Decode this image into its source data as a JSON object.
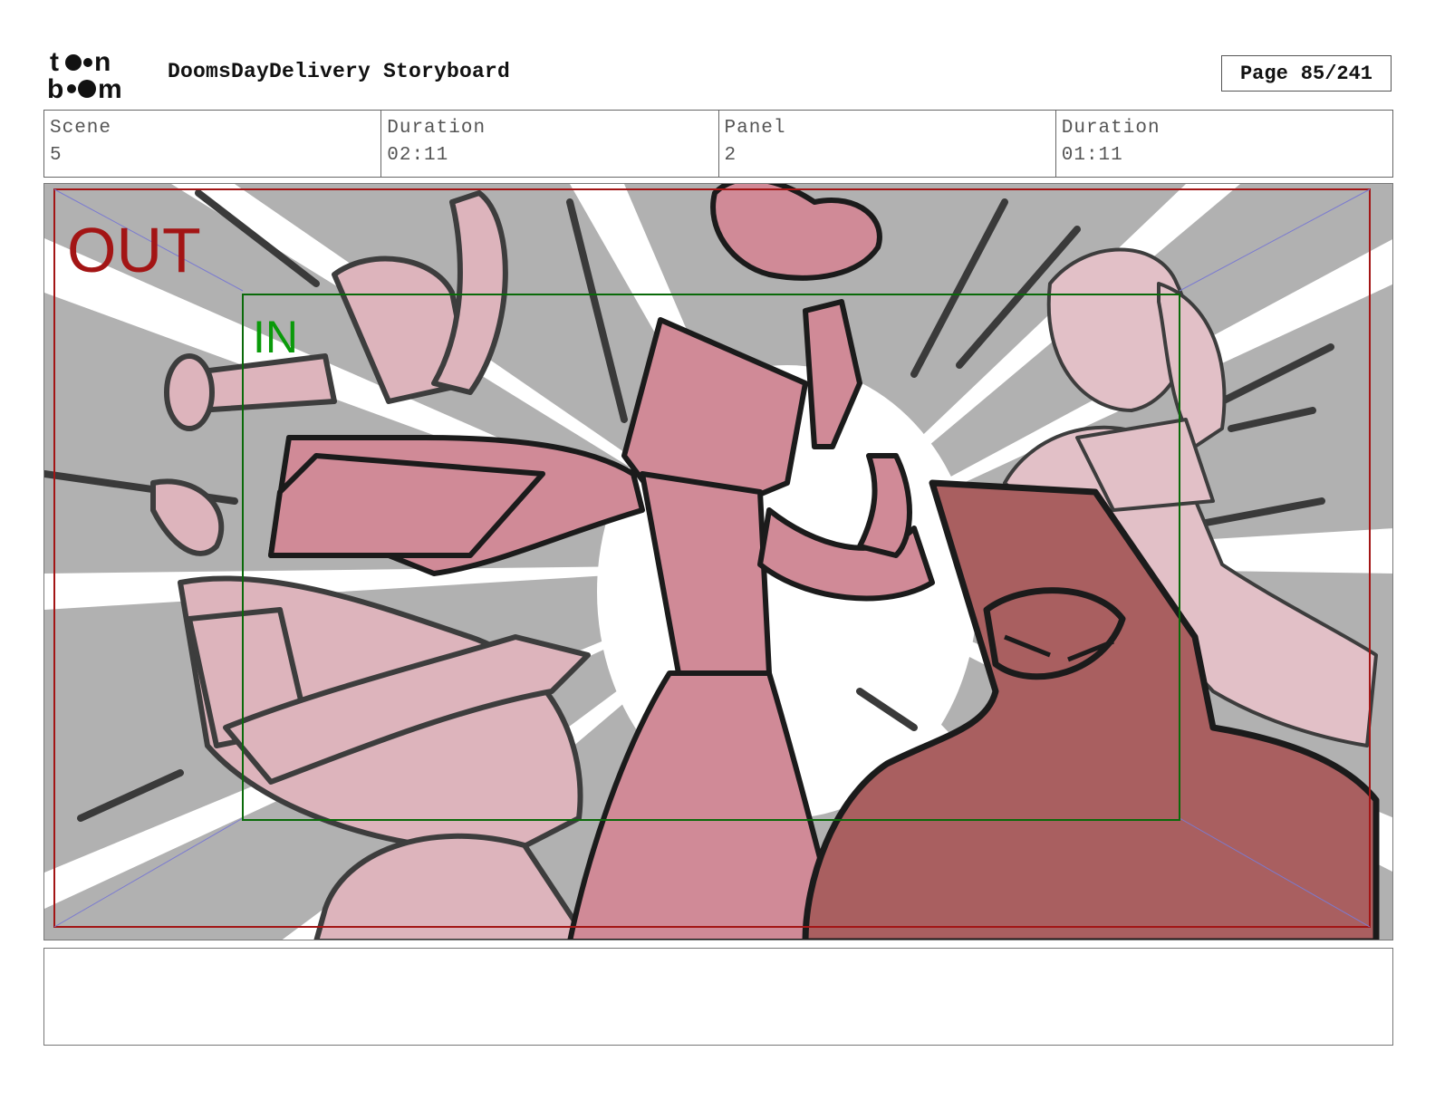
{
  "header": {
    "logo_text": "toonboom",
    "title": "DoomsDayDelivery Storyboard",
    "page_label": "Page",
    "page_value": "85/241"
  },
  "info": {
    "scene_label": "Scene",
    "scene_value": "5",
    "scene_duration_label": "Duration",
    "scene_duration_value": "02:11",
    "panel_label": "Panel",
    "panel_value": "2",
    "panel_duration_label": "Duration",
    "panel_duration_value": "01:11"
  },
  "frame": {
    "out_label": "OUT",
    "in_label": "IN",
    "out_color": "#a31515",
    "in_color": "#0a9a0a"
  },
  "colors": {
    "pink_light": "#ddb4bc",
    "pink_mid": "#d08a97",
    "red_dark": "#a95f60",
    "gray_bg": "#b1b1b1"
  },
  "notes": ""
}
